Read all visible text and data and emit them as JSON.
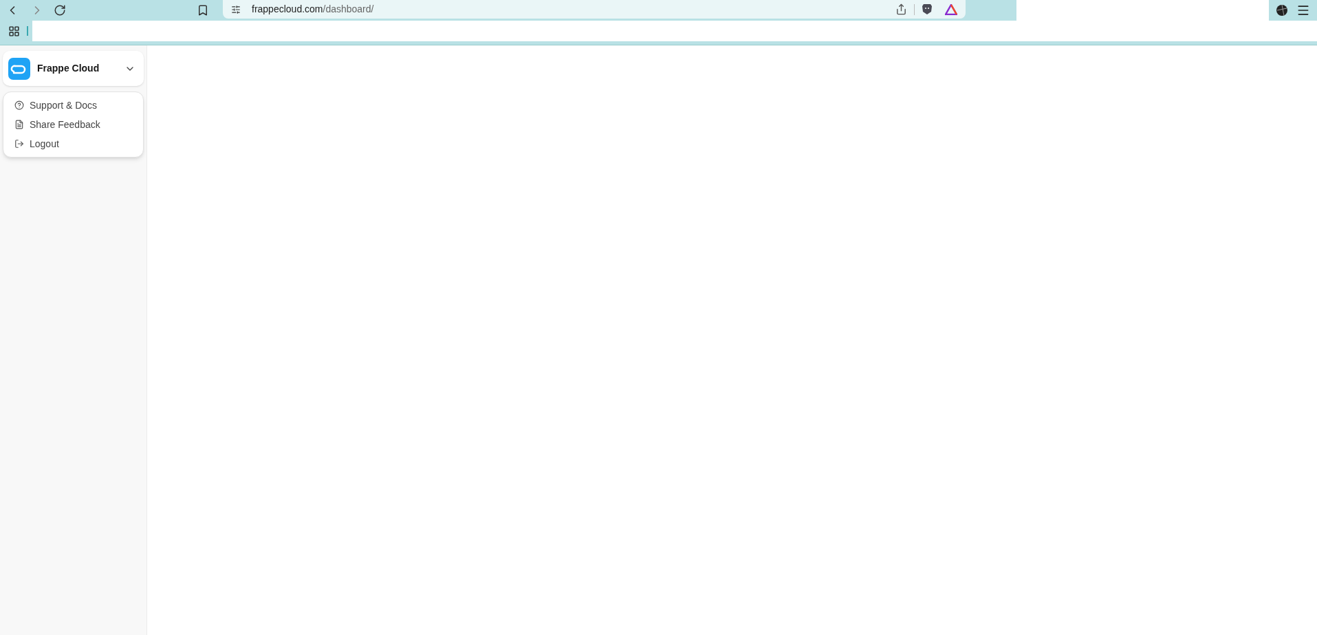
{
  "browser": {
    "address_host": "frappecloud.com",
    "address_path": "/dashboard/"
  },
  "sidebar": {
    "header": {
      "title": "Frappe Cloud",
      "expanded": true
    },
    "menu": [
      {
        "label": "Support & Docs",
        "kind": "help"
      },
      {
        "label": "Share Feedback",
        "kind": "feedback"
      },
      {
        "label": "Logout",
        "kind": "logout"
      }
    ]
  }
}
